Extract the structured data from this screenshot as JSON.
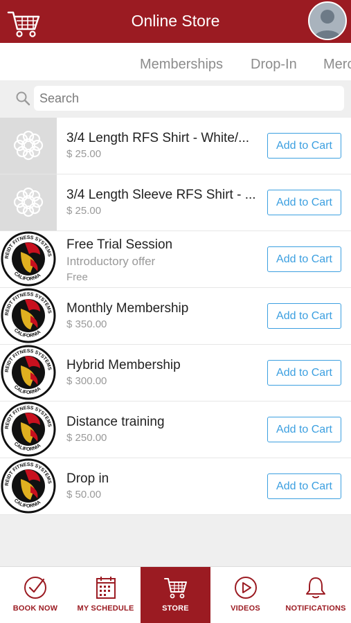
{
  "header": {
    "title": "Online Store",
    "cart_icon": "cart-icon",
    "avatar_icon": "user-avatar-icon"
  },
  "tabs": [
    {
      "label": "Memberships"
    },
    {
      "label": "Drop-In"
    },
    {
      "label": "Merc"
    }
  ],
  "search": {
    "placeholder": "Search"
  },
  "products": [
    {
      "name": "3/4 Length RFS Shirt - White/...",
      "subtitle": "",
      "price": "$ 25.00",
      "thumb": "placeholder-logo-icon",
      "button": "Add to Cart"
    },
    {
      "name": "3/4 Length Sleeve RFS Shirt - ...",
      "subtitle": "",
      "price": "$ 25.00",
      "thumb": "placeholder-logo-icon",
      "button": "Add to Cart"
    },
    {
      "name": "Free Trial Session",
      "subtitle": "Introductory offer",
      "price": "Free",
      "thumb": "reidt-fitness-logo",
      "button": "Add to Cart"
    },
    {
      "name": "Monthly Membership",
      "subtitle": "",
      "price": "$ 350.00",
      "thumb": "reidt-fitness-logo",
      "button": "Add to Cart"
    },
    {
      "name": "Hybrid Membership",
      "subtitle": "",
      "price": "$ 300.00",
      "thumb": "reidt-fitness-logo",
      "button": "Add to Cart"
    },
    {
      "name": "Distance training",
      "subtitle": "",
      "price": "$ 250.00",
      "thumb": "reidt-fitness-logo",
      "button": "Add to Cart"
    },
    {
      "name": "Drop in",
      "subtitle": "",
      "price": "$ 50.00",
      "thumb": "reidt-fitness-logo",
      "button": "Add to Cart"
    }
  ],
  "logo_text": {
    "top": "REIDT FITNESS SYSTEMS",
    "bottom": "CALIFORNIA"
  },
  "nav": [
    {
      "label": "BOOK NOW",
      "icon": "check-circle-icon"
    },
    {
      "label": "MY SCHEDULE",
      "icon": "calendar-icon"
    },
    {
      "label": "STORE",
      "icon": "cart-icon",
      "active": true
    },
    {
      "label": "VIDEOS",
      "icon": "play-circle-icon"
    },
    {
      "label": "NOTIFICATIONS",
      "icon": "bell-icon"
    }
  ],
  "colors": {
    "brand": "#9b1b22",
    "accent": "#3b9fe0",
    "muted": "#999999"
  }
}
